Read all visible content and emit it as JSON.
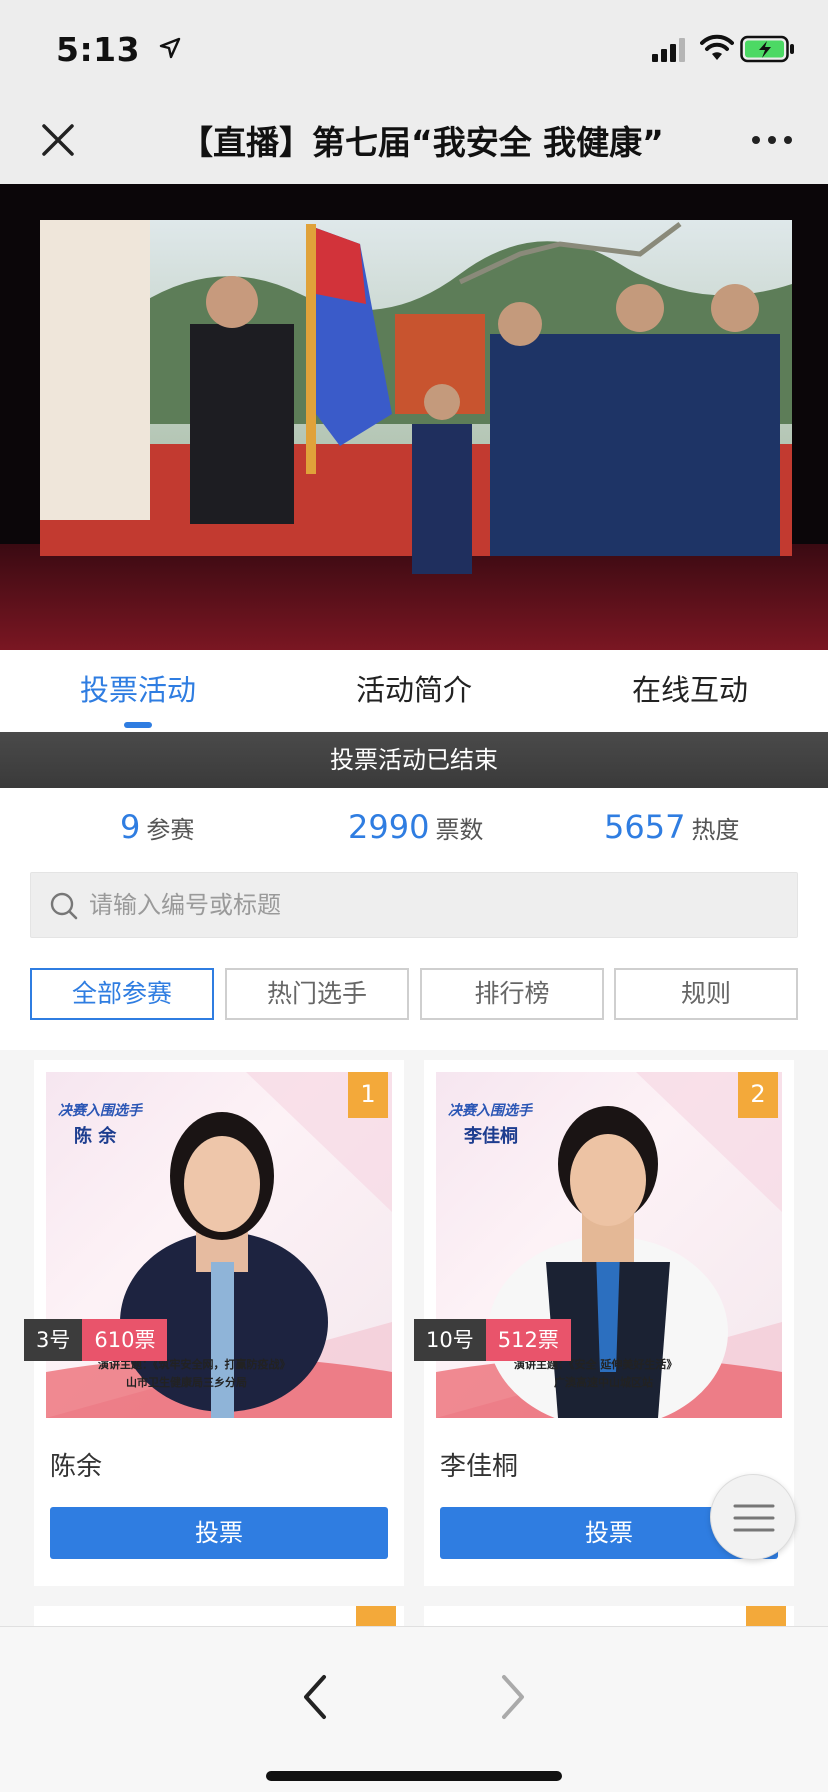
{
  "status_bar": {
    "time": "5:13"
  },
  "nav": {
    "title": "【直播】第七届“我安全 我健康”"
  },
  "tabs": [
    {
      "label": "投票活动",
      "active": true
    },
    {
      "label": "活动简介",
      "active": false
    },
    {
      "label": "在线互动",
      "active": false
    }
  ],
  "banner": {
    "text": "投票活动已结束"
  },
  "stats": {
    "participants": {
      "value": "9",
      "label": "参赛"
    },
    "votes": {
      "value": "2990",
      "label": "票数"
    },
    "heat": {
      "value": "5657",
      "label": "热度"
    }
  },
  "search": {
    "placeholder": "请输入编号或标题"
  },
  "filters": [
    {
      "label": "全部参赛",
      "active": true
    },
    {
      "label": "热门选手",
      "active": false
    },
    {
      "label": "排行榜",
      "active": false
    },
    {
      "label": "规则",
      "active": false
    }
  ],
  "candidates": [
    {
      "rank": "1",
      "number": "3号",
      "votes": "610票",
      "name": "陈余",
      "vote_label": "投票",
      "poster_badge": "决赛入围选手",
      "poster_name": "陈 余",
      "poster_topic": "演讲主题：《筑牢安全网，打赢防疫战》",
      "poster_org": "山市卫生健康局三乡分局"
    },
    {
      "rank": "2",
      "number": "10号",
      "votes": "512票",
      "name": "李佳桐",
      "vote_label": "投票",
      "poster_badge": "决赛入围选手",
      "poster_name": "李佳桐",
      "poster_topic": "演讲主题：《安全 延伸美好生活》",
      "poster_org": "广澳高速中山城区站"
    }
  ],
  "colors": {
    "accent": "#2f7de1",
    "rank_badge": "#f3a93a",
    "votes_tag": "#e9546b",
    "banner": "#3f3f3f"
  },
  "icons": {
    "close": "close-icon",
    "more": "more-icon",
    "search": "search-icon",
    "menu": "menu-icon",
    "back": "chevron-left-icon",
    "forward": "chevron-right-icon"
  }
}
